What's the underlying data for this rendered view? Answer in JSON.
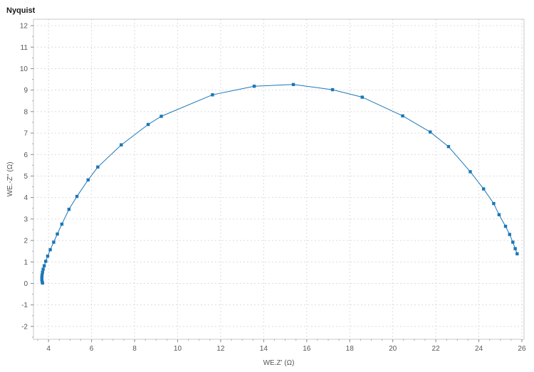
{
  "header": {
    "title": "Nyquist"
  },
  "chart_data": {
    "type": "scatter",
    "title": "Nyquist",
    "xlabel": "WE.Z' (Ω)",
    "ylabel": "WE.-Z'' (Ω)",
    "xlim": [
      3.3,
      26.1
    ],
    "ylim": [
      -2.6,
      12.3
    ],
    "xticks": [
      4,
      6,
      8,
      10,
      12,
      14,
      16,
      18,
      20,
      22,
      24,
      26
    ],
    "yticks": [
      -2,
      -1,
      0,
      1,
      2,
      3,
      4,
      5,
      6,
      7,
      8,
      9,
      10,
      11,
      12
    ],
    "grid": true,
    "series": [
      {
        "color": "#1a77b8",
        "line": true,
        "markers": "square",
        "x": [
          3.72,
          3.7,
          3.69,
          3.69,
          3.7,
          3.72,
          3.75,
          3.8,
          3.87,
          3.96,
          4.08,
          4.24,
          4.41,
          4.62,
          4.95,
          5.32,
          5.84,
          6.29,
          7.38,
          8.63,
          9.24,
          11.62,
          13.56,
          15.38,
          17.2,
          18.58,
          20.46,
          21.74,
          22.59,
          23.6,
          24.22,
          24.69,
          24.94,
          25.24,
          25.43,
          25.58,
          25.69,
          25.78
        ],
        "y": [
          0.02,
          0.1,
          0.18,
          0.28,
          0.39,
          0.52,
          0.66,
          0.82,
          1.03,
          1.27,
          1.57,
          1.92,
          2.3,
          2.76,
          3.45,
          4.05,
          4.82,
          5.42,
          6.45,
          7.4,
          7.78,
          8.78,
          9.18,
          9.26,
          9.02,
          8.67,
          7.8,
          7.05,
          6.37,
          5.2,
          4.4,
          3.72,
          3.2,
          2.66,
          2.28,
          1.92,
          1.62,
          1.38
        ]
      }
    ]
  }
}
